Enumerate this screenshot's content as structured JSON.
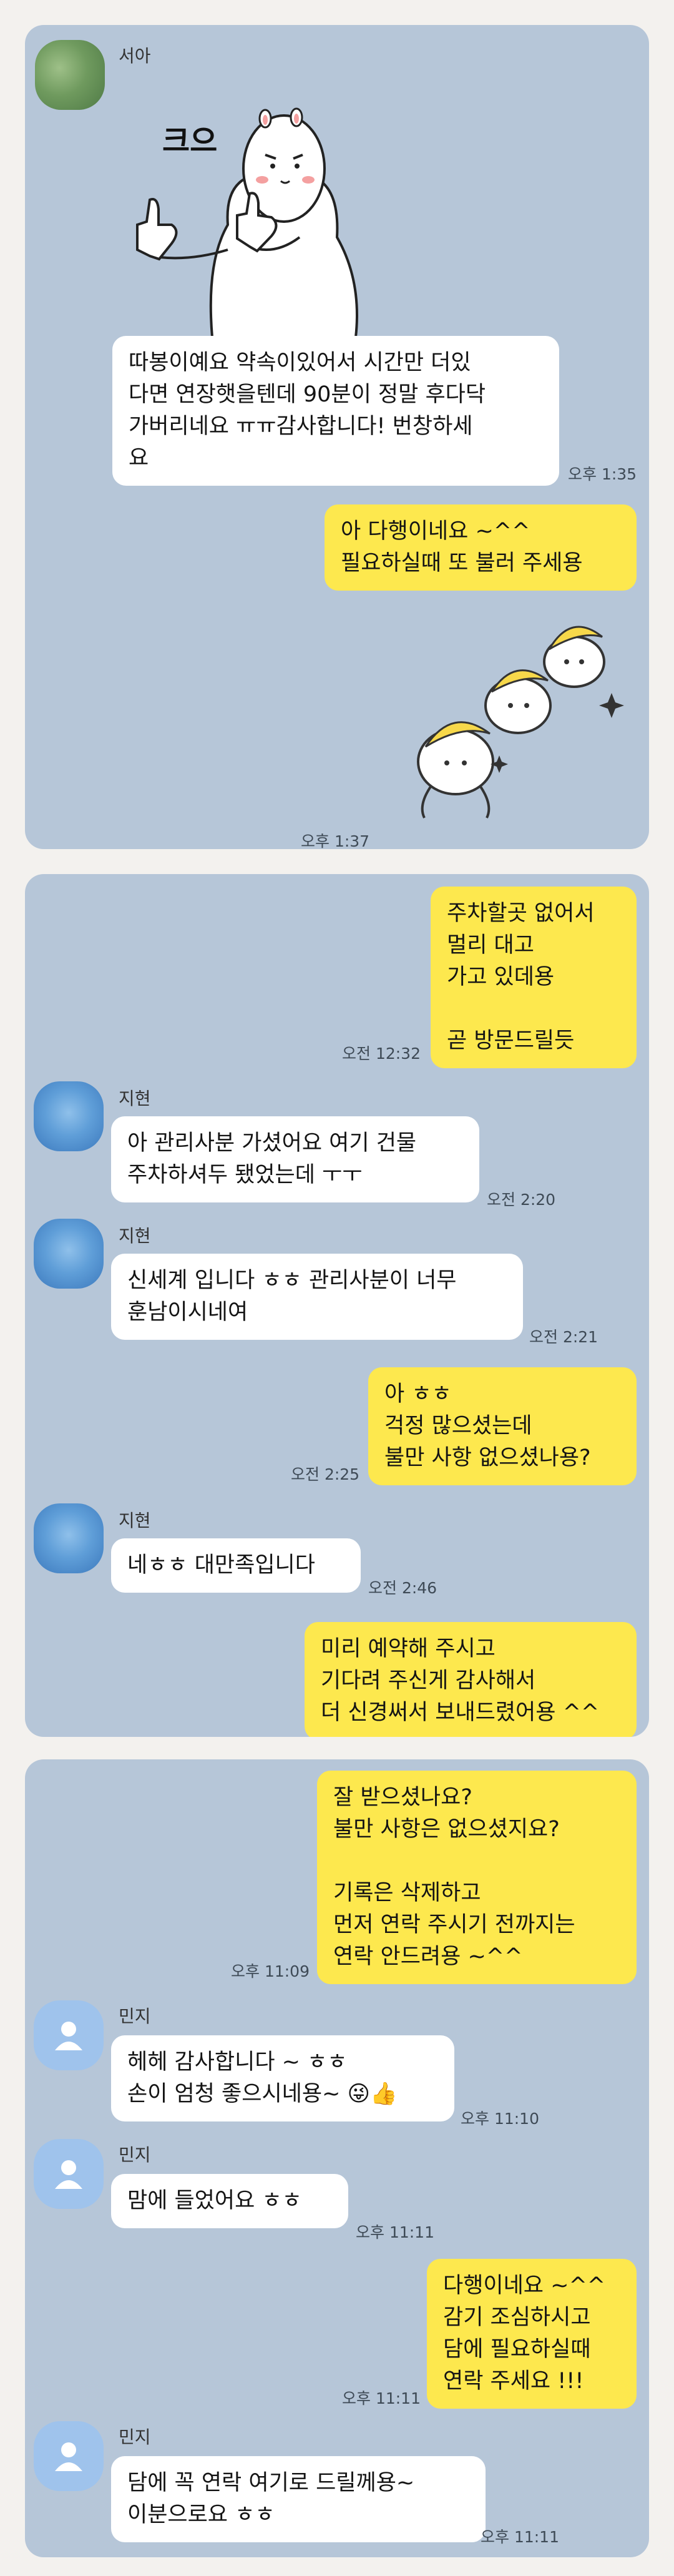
{
  "sections": [
    {
      "messages": [
        {
          "sender": "서아",
          "type": "sticker",
          "sticker_text": "크으"
        },
        {
          "type": "text",
          "side": "left",
          "lines": [
            "따봉이예요 약속이있어서 시간만 더있",
            "다면 연장햇을텐데 90분이 정말 후다닥",
            "가버리네요 ㅠㅠ감사합니다! 번창하세",
            "요"
          ],
          "time": "오후 1:35"
        },
        {
          "type": "text",
          "side": "right",
          "lines": [
            "아 다행이네요 ~^^",
            "필요하실때 또 불러 주세용"
          ]
        },
        {
          "type": "sticker",
          "side": "right",
          "time": "오후 1:37"
        }
      ]
    },
    {
      "messages": [
        {
          "type": "text",
          "side": "right",
          "lines": [
            "주차할곳 없어서",
            "멀리 대고",
            "가고 있데용",
            "",
            "곧 방문드릴듯"
          ],
          "time": "오전 12:32"
        },
        {
          "sender": "지현",
          "type": "text",
          "side": "left",
          "lines": [
            "아 관리사분 가셨어요 여기 건물",
            "주차하셔두 됐었는데 ㅜㅜ"
          ],
          "time": "오전 2:20"
        },
        {
          "sender": "지현",
          "type": "text",
          "side": "left",
          "lines": [
            "신세계 입니다 ㅎㅎ 관리사분이 너무",
            "훈남이시네여"
          ],
          "time": "오전 2:21"
        },
        {
          "type": "text",
          "side": "right",
          "lines": [
            "아 ㅎㅎ",
            "걱정 많으셨는데",
            "불만 사항 없으셨나용?"
          ],
          "time": "오전 2:25"
        },
        {
          "sender": "지현",
          "type": "text",
          "side": "left",
          "lines": [
            "네ㅎㅎ 대만족입니다"
          ],
          "time": "오전 2:46"
        },
        {
          "type": "text",
          "side": "right",
          "lines": [
            "미리 예약해 주시고",
            "기다려 주신게 감사해서",
            "더 신경써서 보내드렸어용 ^^"
          ]
        }
      ]
    },
    {
      "messages": [
        {
          "type": "text",
          "side": "right",
          "lines": [
            "잘 받으셨나요?",
            "불만 사항은 없으셨지요?",
            "",
            "기록은 삭제하고",
            "먼저 연락 주시기 전까지는",
            "연락 안드려용 ~^^"
          ],
          "time": "오후 11:09"
        },
        {
          "sender": "민지",
          "type": "text",
          "side": "left",
          "lines": [
            "헤헤 감사합니다 ~ ㅎㅎ",
            "손이 엄청 좋으시네용~ 😜👍"
          ],
          "time": "오후 11:10"
        },
        {
          "sender": "민지",
          "type": "text",
          "side": "left",
          "lines": [
            "맘에 들었어요 ㅎㅎ"
          ],
          "time": "오후 11:11"
        },
        {
          "type": "text",
          "side": "right",
          "lines": [
            "다행이네요 ~^^",
            "감기 조심하시고",
            "담에 필요하실때",
            "연락 주세요 !!!"
          ],
          "time": "오후 11:11"
        },
        {
          "sender": "민지",
          "type": "text",
          "side": "left",
          "lines": [
            "담에 꼭 연락 여기로 드릴께용~",
            "이분으로요 ㅎㅎ"
          ],
          "time": "오후 11:11"
        }
      ]
    }
  ],
  "icons": {
    "avatar_1": "blurred-green-avatar",
    "avatar_2": "blurred-blue-avatar",
    "avatar_3": "default-person-avatar",
    "sticker_1": "thumbs-up-bear-sticker",
    "sticker_2": "banana-hat-characters-sticker"
  },
  "colors": {
    "chat_background": "#b6c6d8",
    "my_bubble": "#fde84e",
    "their_bubble": "#ffffff",
    "page_background": "#f3f1ee"
  }
}
